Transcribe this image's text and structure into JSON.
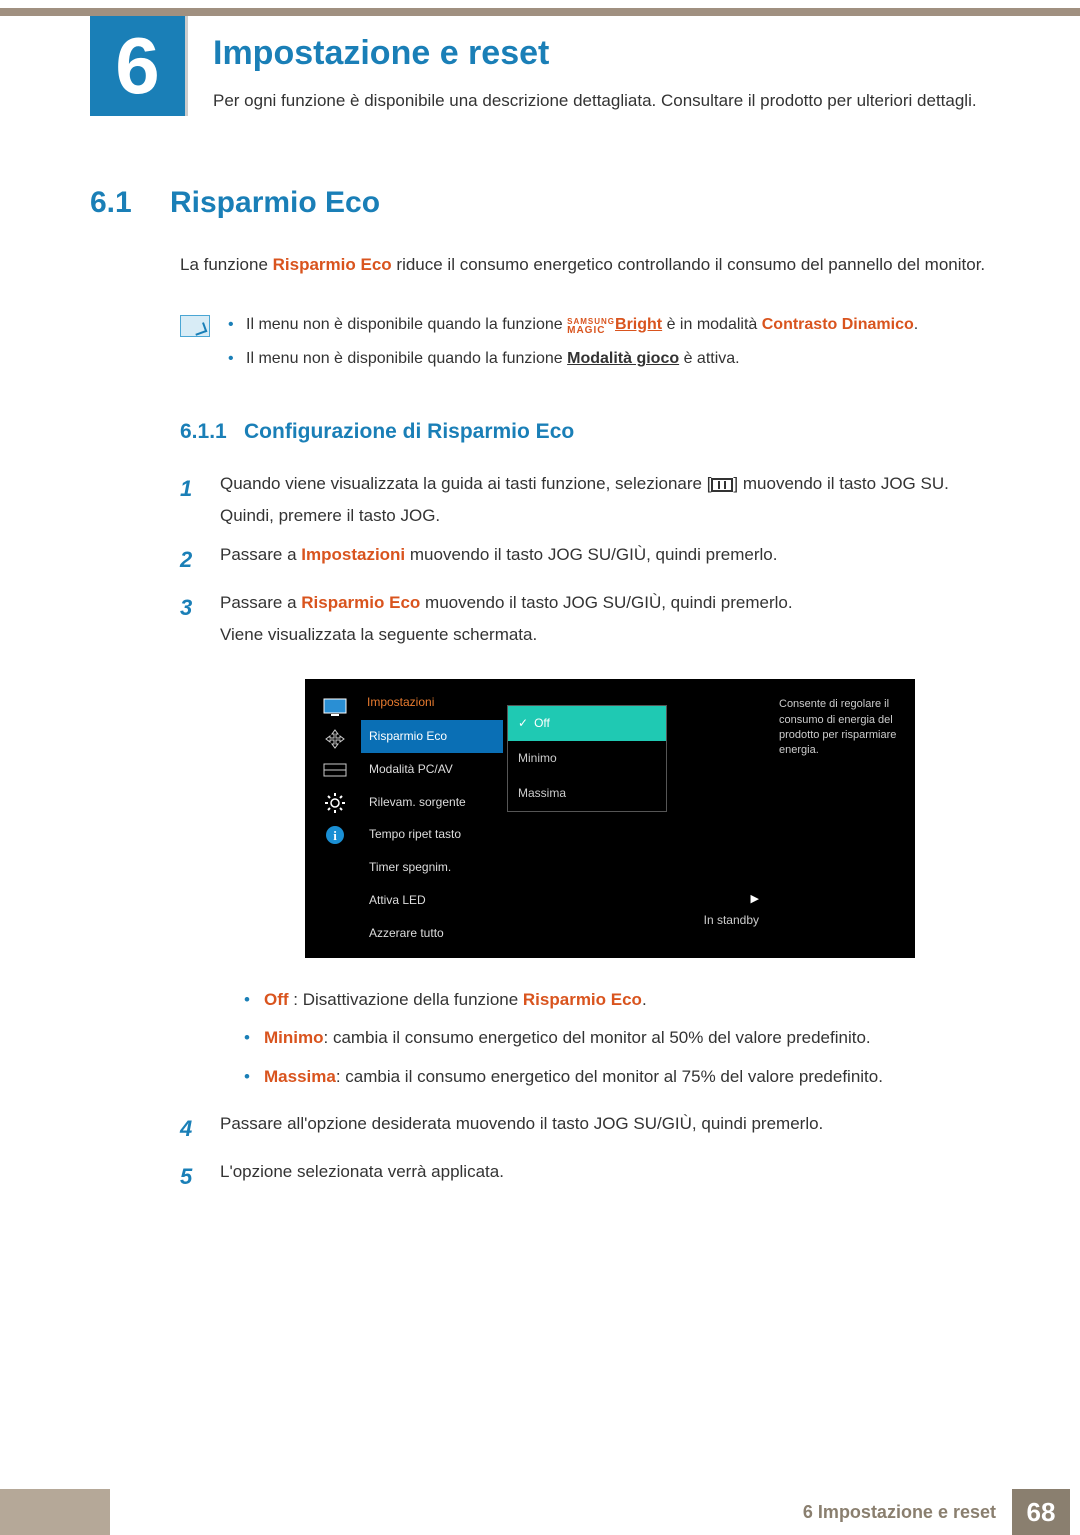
{
  "chapter": {
    "number": "6",
    "title": "Impostazione e reset",
    "description": "Per ogni funzione è disponibile una descrizione dettagliata. Consultare il prodotto per ulteriori dettagli."
  },
  "section": {
    "number": "6.1",
    "title": "Risparmio Eco",
    "intro_a": "La funzione ",
    "intro_b": "Risparmio Eco",
    "intro_c": " riduce il consumo energetico controllando il consumo del pannello del monitor."
  },
  "notes": {
    "n1_a": "Il menu non è disponibile quando la funzione ",
    "n1_magic_top": "SAMSUNG",
    "n1_magic_bot": "MAGIC",
    "n1_bright": "Bright",
    "n1_b": " è in modalità ",
    "n1_c": "Contrasto Dinamico",
    "n1_d": ".",
    "n2_a": "Il menu non è disponibile quando la funzione ",
    "n2_b": "Modalità gioco",
    "n2_c": " è attiva."
  },
  "subsection": {
    "number": "6.1.1",
    "title": "Configurazione di Risparmio Eco"
  },
  "steps": {
    "s1": "1",
    "s1_a": "Quando viene visualizzata la guida ai tasti funzione, selezionare [",
    "s1_b": "] muovendo il tasto JOG SU. Quindi, premere il tasto JOG.",
    "s2": "2",
    "s2_a": "Passare a ",
    "s2_b": "Impostazioni",
    "s2_c": " muovendo il tasto JOG SU/GIÙ, quindi premerlo.",
    "s3": "3",
    "s3_a": "Passare a ",
    "s3_b": "Risparmio Eco",
    "s3_c": " muovendo il tasto JOG SU/GIÙ, quindi premerlo.",
    "s3_d": "Viene visualizzata la seguente schermata.",
    "s4": "4",
    "s4_a": "Passare all'opzione desiderata muovendo il tasto JOG SU/GIÙ, quindi premerlo.",
    "s5": "5",
    "s5_a": "L'opzione selezionata verrà applicata."
  },
  "osd": {
    "header": "Impostazioni",
    "items": [
      "Risparmio Eco",
      "Modalità PC/AV",
      "Rilevam. sorgente",
      "Tempo ripet tasto",
      "Timer spegnim.",
      "Attiva LED",
      "Azzerare tutto"
    ],
    "sub": [
      "Off",
      "Minimo",
      "Massima"
    ],
    "standby": "In standby",
    "desc": "Consente di regolare il consumo di energia del prodotto per risparmiare energia."
  },
  "options": {
    "off_label": "Off",
    "off_text": " : Disattivazione della funzione ",
    "off_ref": "Risparmio Eco",
    "off_end": ".",
    "min_label": "Minimo",
    "min_text": ": cambia il consumo energetico del monitor al 50% del valore predefinito.",
    "max_label": "Massima",
    "max_text": ": cambia il consumo energetico del monitor al 75% del valore predefinito."
  },
  "footer": {
    "label": "6 Impostazione e reset",
    "page": "68"
  }
}
